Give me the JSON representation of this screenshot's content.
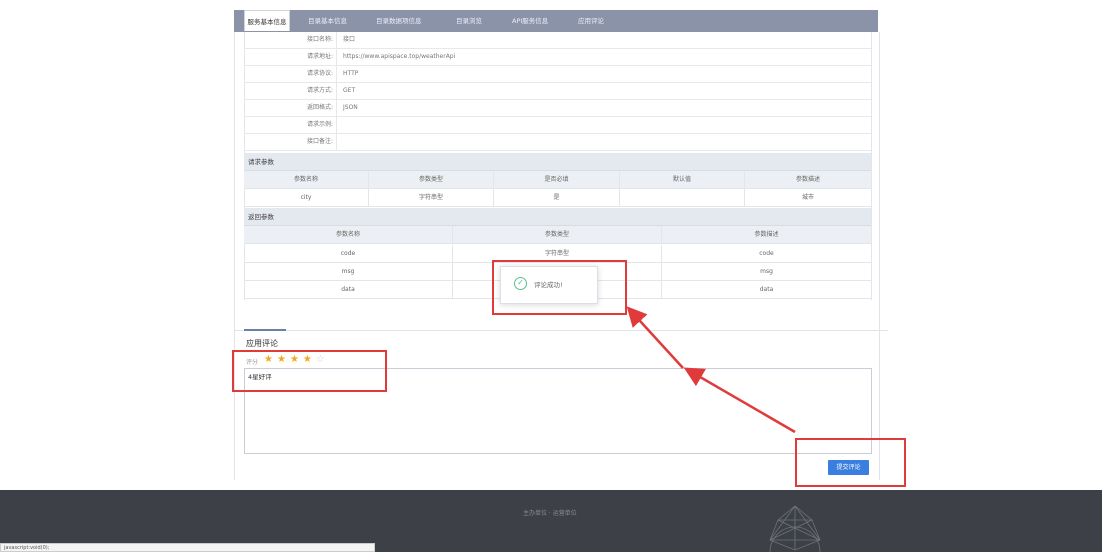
{
  "tabs": [
    {
      "label": "服务基本信息",
      "active": true
    },
    {
      "label": "目录基本信息",
      "active": false
    },
    {
      "label": "目录数据项信息",
      "active": false
    },
    {
      "label": "目录浏览",
      "active": false
    },
    {
      "label": "API服务信息",
      "active": false
    },
    {
      "label": "应用评论",
      "active": false
    }
  ],
  "api_info": [
    {
      "key": "接口名称:",
      "value": "接口"
    },
    {
      "key": "请求地址:",
      "value": "https://www.apispace.top/weatherApi"
    },
    {
      "key": "请求协议:",
      "value": "HTTP"
    },
    {
      "key": "请求方式:",
      "value": "GET"
    },
    {
      "key": "返回格式:",
      "value": "JSON"
    },
    {
      "key": "请求示例:",
      "value": ""
    },
    {
      "key": "接口备注:",
      "value": ""
    }
  ],
  "request_params": {
    "title": "请求参数",
    "headers": [
      "参数名称",
      "参数类型",
      "是否必填",
      "默认值",
      "参数描述"
    ],
    "rows": [
      [
        "city",
        "字符串型",
        "是",
        "",
        "城市"
      ]
    ]
  },
  "response_params": {
    "title": "返回参数",
    "headers": [
      "参数名称",
      "参数类型",
      "参数描述"
    ],
    "rows": [
      [
        "code",
        "字符串型",
        "code"
      ],
      [
        "msg",
        "",
        "msg"
      ],
      [
        "data",
        "",
        "data"
      ]
    ]
  },
  "toast": {
    "message": "评论成功!",
    "icon": "check-circle-icon"
  },
  "comment": {
    "title": "应用评论",
    "rating_label": "评分",
    "rating": 4,
    "max_rating": 5,
    "text": "4星好评",
    "submit_label": "提交评论"
  },
  "footer": {
    "text": "主办单位 · 运营单位"
  },
  "status_bar": {
    "text": "javascript:void(0);"
  },
  "colors": {
    "tabbar": "#8b93a8",
    "highlight": "#e03b3b",
    "primary_button": "#3a7fe0",
    "star": "#f5a623",
    "footer": "#3d4047"
  }
}
